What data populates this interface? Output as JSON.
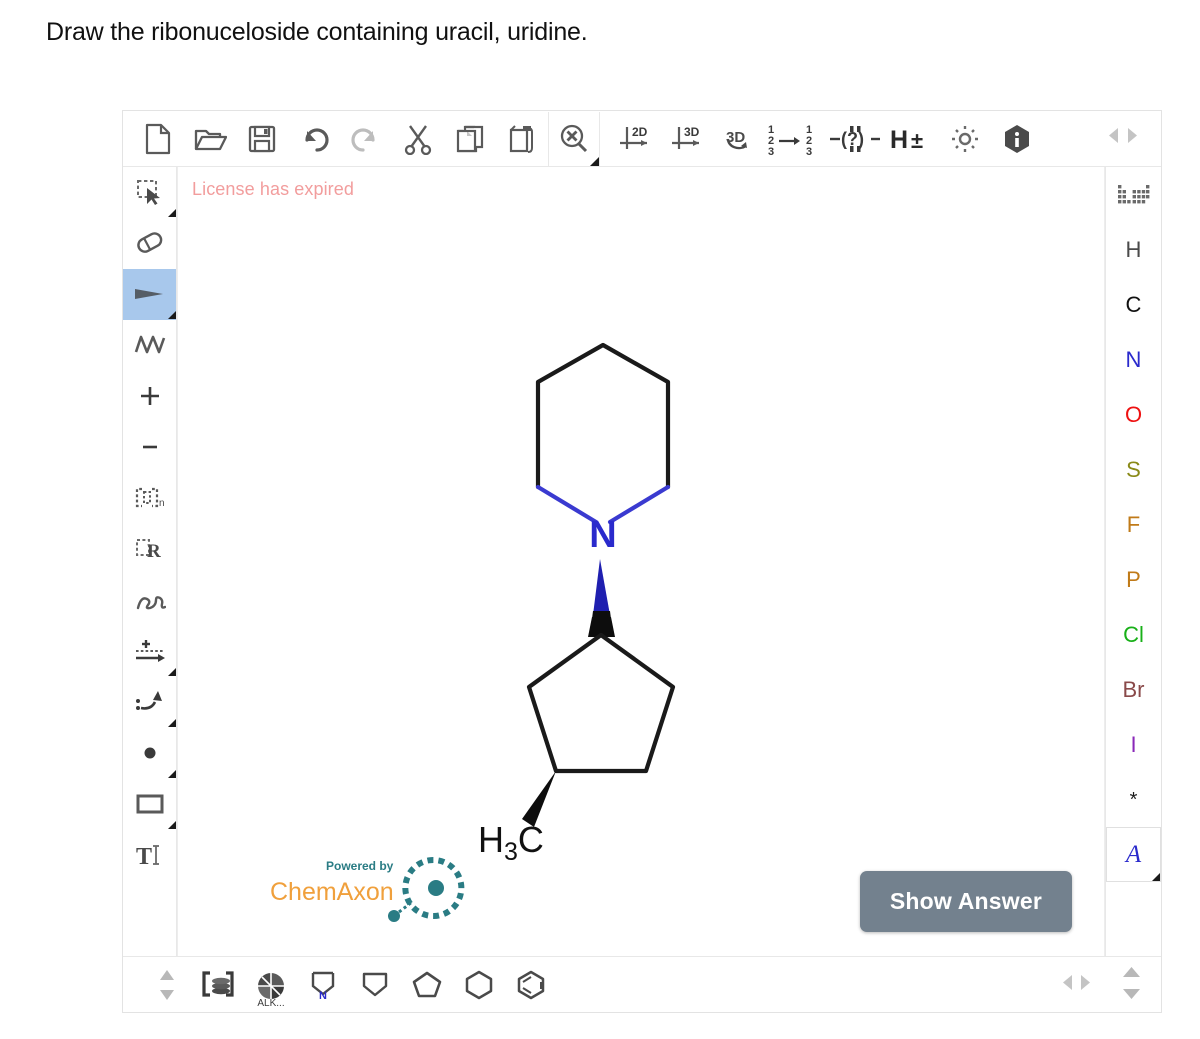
{
  "question": {
    "text": "Draw the ribonuceloside containing uracil, uridine."
  },
  "toolbar": {
    "buttons": [
      {
        "name": "new-file-icon",
        "label": "New"
      },
      {
        "name": "open-folder-icon",
        "label": "Open"
      },
      {
        "name": "save-icon",
        "label": "Save"
      },
      {
        "name": "undo-icon",
        "label": "Undo"
      },
      {
        "name": "redo-icon",
        "label": "Redo"
      },
      {
        "name": "cut-scissors-icon",
        "label": "Cut"
      },
      {
        "name": "copy-icon",
        "label": "Copy"
      },
      {
        "name": "paste-icon",
        "label": "Paste"
      },
      {
        "name": "zoom-clear-icon",
        "label": "Clear / Zoom"
      },
      {
        "name": "clean-2d-icon",
        "label": "2D"
      },
      {
        "name": "clean-3d-icon",
        "label": "3D"
      },
      {
        "name": "rotate-3d-icon",
        "label": "3D Rotate"
      },
      {
        "name": "renumber-icon",
        "label": "Renumber"
      },
      {
        "name": "query-bond-icon",
        "label": "Query bond"
      },
      {
        "name": "hydrogen-toggle-icon",
        "label": "H±"
      },
      {
        "name": "settings-gear-icon",
        "label": "Settings"
      },
      {
        "name": "info-icon",
        "label": "Info"
      }
    ],
    "nav": {
      "prev": "prev-arrow-icon",
      "next": "next-arrow-icon"
    }
  },
  "left_tools": [
    {
      "name": "select-tool",
      "label": "Selection",
      "selected": false,
      "dropdown": true
    },
    {
      "name": "eraser-tool",
      "label": "Eraser",
      "selected": false,
      "dropdown": false
    },
    {
      "name": "wedge-bond-tool",
      "label": "Wedge bond",
      "selected": true,
      "dropdown": true
    },
    {
      "name": "chain-tool",
      "label": "Chain",
      "selected": false,
      "dropdown": false
    },
    {
      "name": "increase-charge-tool",
      "label": "+",
      "selected": false,
      "dropdown": false
    },
    {
      "name": "decrease-charge-tool",
      "label": "-",
      "selected": false,
      "dropdown": false
    },
    {
      "name": "repeating-group-tool",
      "label": "Repeating group",
      "selected": false,
      "dropdown": false
    },
    {
      "name": "r-group-tool",
      "label": "R-group",
      "selected": false,
      "dropdown": false
    },
    {
      "name": "lasso-tool",
      "label": "Freehand",
      "selected": false,
      "dropdown": false
    },
    {
      "name": "reaction-arrow-tool",
      "label": "Reaction arrow",
      "selected": false,
      "dropdown": true
    },
    {
      "name": "electron-flow-tool",
      "label": "Electron flow",
      "selected": false,
      "dropdown": true
    },
    {
      "name": "atom-dot-tool",
      "label": "Lone pair",
      "selected": false,
      "dropdown": true
    },
    {
      "name": "frame-tool",
      "label": "Frame",
      "selected": false,
      "dropdown": true
    },
    {
      "name": "text-tool",
      "label": "Text",
      "selected": false,
      "dropdown": false
    }
  ],
  "canvas": {
    "license_message": "License has expired",
    "show_answer_label": "Show Answer",
    "watermark": {
      "powered_by": "Powered by",
      "brand": "ChemAxon",
      "powered_color": "#2a7c84",
      "brand_color": "#f0a03c"
    },
    "molecule": {
      "description": "1-(3-methylcyclopentyl)piperidine drawn with bold wedge stereo bonds",
      "atom_labels": [
        {
          "text": "N",
          "color": "#2a2acc"
        },
        {
          "text": "H3C",
          "color": "#1a1a1a"
        }
      ],
      "bond_color": "#1a1a1a",
      "hetero_bond_color": "#3a3ad0"
    }
  },
  "elements": [
    {
      "name": "periodic-table-icon",
      "label": "",
      "color": "#555555",
      "icon": true,
      "boxed": false
    },
    {
      "name": "element-H",
      "label": "H",
      "color": "#4a4a4a",
      "icon": false,
      "boxed": false
    },
    {
      "name": "element-C",
      "label": "C",
      "color": "#111111",
      "icon": false,
      "boxed": false
    },
    {
      "name": "element-N",
      "label": "N",
      "color": "#2a2acc",
      "icon": false,
      "boxed": false
    },
    {
      "name": "element-O",
      "label": "O",
      "color": "#ee1111",
      "icon": false,
      "boxed": false
    },
    {
      "name": "element-S",
      "label": "S",
      "color": "#8a8a18",
      "icon": false,
      "boxed": false
    },
    {
      "name": "element-F",
      "label": "F",
      "color": "#c07a18",
      "icon": false,
      "boxed": false
    },
    {
      "name": "element-P",
      "label": "P",
      "color": "#c07a18",
      "icon": false,
      "boxed": false
    },
    {
      "name": "element-Cl",
      "label": "Cl",
      "color": "#18b018",
      "icon": false,
      "boxed": false
    },
    {
      "name": "element-Br",
      "label": "Br",
      "color": "#8a4a4a",
      "icon": false,
      "boxed": false
    },
    {
      "name": "element-I",
      "label": "I",
      "color": "#8a28b8",
      "icon": false,
      "boxed": false
    },
    {
      "name": "element-any",
      "label": "*",
      "color": "#1a1a1a",
      "icon": false,
      "boxed": false
    },
    {
      "name": "element-A",
      "label": "A",
      "color": "#2a2acc",
      "icon": false,
      "boxed": true
    }
  ],
  "templates": {
    "items": [
      {
        "name": "template-scroll-stepper",
        "label": ""
      },
      {
        "name": "template-group-bracket",
        "label": ""
      },
      {
        "name": "template-alkaloid",
        "label": "ALK..."
      },
      {
        "name": "template-azetidine",
        "label": ""
      },
      {
        "name": "template-cyclobutane",
        "label": ""
      },
      {
        "name": "template-cyclopentane",
        "label": ""
      },
      {
        "name": "template-cyclohexane",
        "label": ""
      },
      {
        "name": "template-benzene",
        "label": ""
      }
    ],
    "nav": {
      "prev": "prev-arrow-icon",
      "next": "next-arrow-icon",
      "up": "up-arrow-icon",
      "down": "down-arrow-icon"
    }
  }
}
